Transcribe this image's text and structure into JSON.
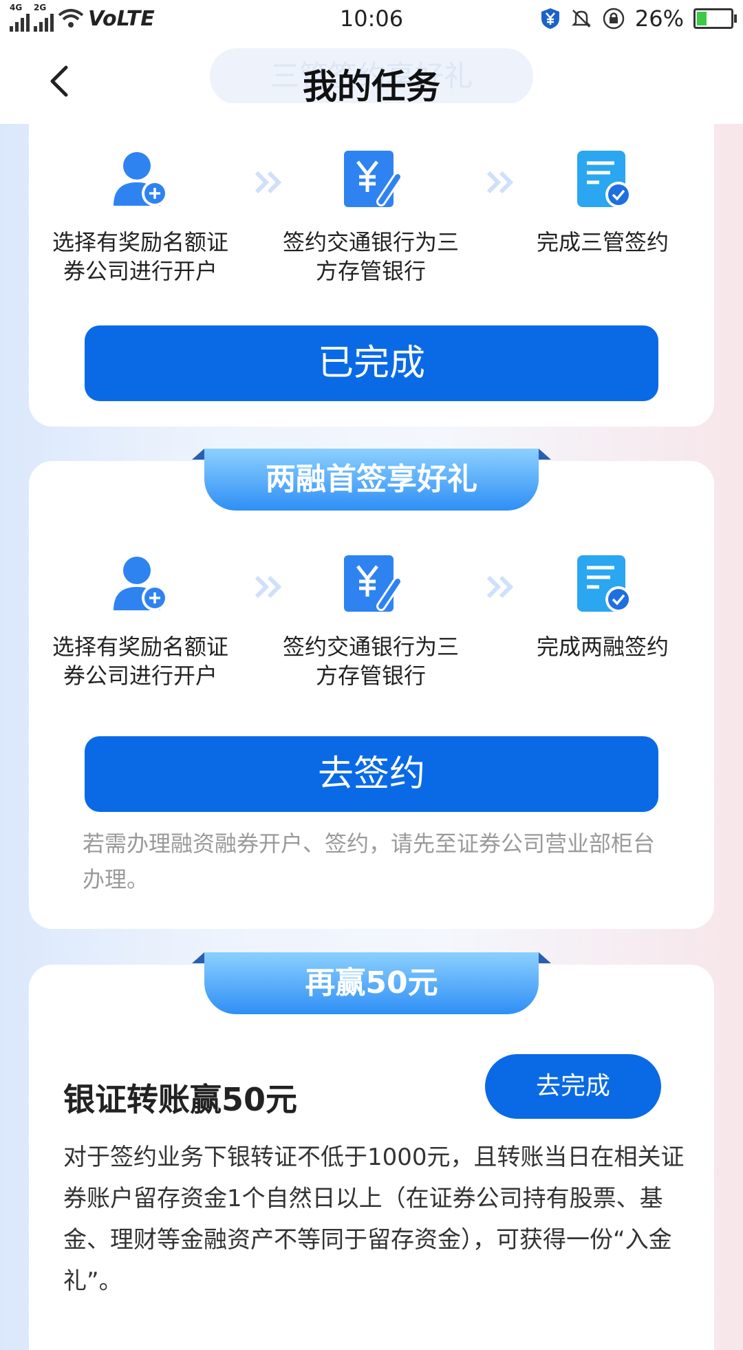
{
  "status_bar": {
    "net1": "4G",
    "net2": "2G",
    "volte": "VoLTE",
    "time": "10:06",
    "battery": "26%"
  },
  "header": {
    "ghost_title": "三管签约享好礼",
    "title": "我的任务"
  },
  "card1": {
    "steps": [
      {
        "icon": "user-add-icon",
        "caption": "选择有奖励名额证券公司进行开户"
      },
      {
        "icon": "yuan-sign-icon",
        "caption": "签约交通银行为三方存管银行"
      },
      {
        "icon": "document-check-icon",
        "caption": "完成三管签约"
      }
    ],
    "button_label": "已完成"
  },
  "card2": {
    "ribbon_label": "两融首签享好礼",
    "steps": [
      {
        "icon": "user-add-icon",
        "caption": "选择有奖励名额证券公司进行开户"
      },
      {
        "icon": "yuan-sign-icon",
        "caption": "签约交通银行为三方存管银行"
      },
      {
        "icon": "document-check-icon",
        "caption": "完成两融签约"
      }
    ],
    "button_label": "去签约",
    "note": "若需办理融资融券开户、签约，请先至证券公司营业部柜台办理。"
  },
  "card3": {
    "ribbon_label": "再赢50元",
    "task_title": "银证转账赢50元",
    "button_label": "去完成",
    "description": "对于签约业务下银转证不低于1000元，且转账当日在相关证券账户留存资金1个自然日以上（在证券公司持有股票、基金、理财等金融资产不等同于留存资金），可获得一份“入金礼”。"
  },
  "colors": {
    "primary": "#0a6ae6",
    "ribbon_top": "#8cd0ff",
    "ribbon_bottom": "#2f8ff5",
    "check": "#1e6fe0"
  }
}
